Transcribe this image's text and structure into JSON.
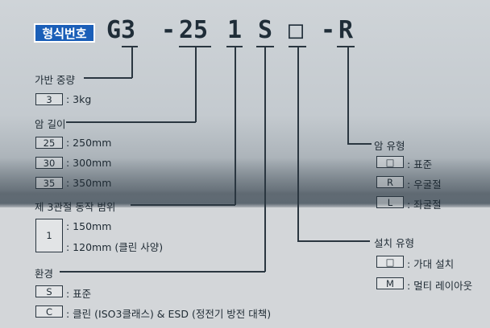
{
  "badge": "형식번호",
  "model": {
    "p1": "G3",
    "d1": "-",
    "p2": "25",
    "p3": "1",
    "p4": "S",
    "p5": "□",
    "d2": "-",
    "p6": "R"
  },
  "payload": {
    "title": "가반 중량",
    "options": [
      {
        "code": "3",
        "desc": ": 3kg"
      }
    ]
  },
  "arm": {
    "title": "암 길이",
    "options": [
      {
        "code": "25",
        "desc": ": 250mm"
      },
      {
        "code": "30",
        "desc": ": 300mm"
      },
      {
        "code": "35",
        "desc": ": 350mm"
      }
    ]
  },
  "joint3": {
    "title": "제 3관절 동작 범위",
    "options": [
      {
        "code": "1",
        "desc1": ": 150mm",
        "desc2": ": 120mm (클린 사양)"
      }
    ]
  },
  "env": {
    "title": "환경",
    "options": [
      {
        "code": "S",
        "desc": ": 표준"
      },
      {
        "code": "C",
        "desc": ": 클린 (ISO3클래스) & ESD (정전기 방전 대책)"
      }
    ]
  },
  "armtype": {
    "title": "암 유형",
    "options": [
      {
        "code": "□",
        "desc": ": 표준"
      },
      {
        "code": "R",
        "desc": ": 우굴절"
      },
      {
        "code": "L",
        "desc": ": 좌굴절"
      }
    ]
  },
  "install": {
    "title": "설치 유형",
    "options": [
      {
        "code": "□",
        "desc": ": 가대 설치"
      },
      {
        "code": "M",
        "desc": ": 멀티 레이아웃"
      }
    ]
  },
  "colors": {
    "badge": "#1b5fb8",
    "text": "#1f2d38"
  }
}
